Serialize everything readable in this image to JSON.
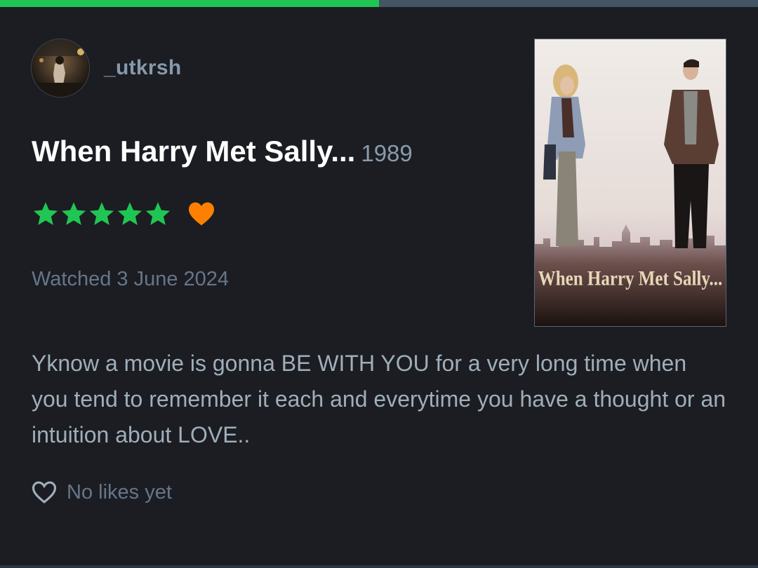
{
  "progress": {
    "fraction": 0.5
  },
  "review": {
    "username": "_utkrsh",
    "avatar_icon": "user-avatar-photo",
    "film_title": "When Harry Met Sally...",
    "film_year": "1989",
    "rating_stars": 5,
    "liked": true,
    "watched_text": "Watched 3 June 2024",
    "body": "Yknow a movie is gonna BE WITH YOU for a very long time when you tend to remember it each and everytime you have a thought or an intuition about LOVE..",
    "likes_text": "No likes yet",
    "poster_title": "When Harry Met Sally..."
  },
  "colors": {
    "background": "#1b1d22",
    "star": "#20c653",
    "heart": "#ff8000",
    "progress_fill": "#20c653",
    "progress_track": "#445566"
  }
}
